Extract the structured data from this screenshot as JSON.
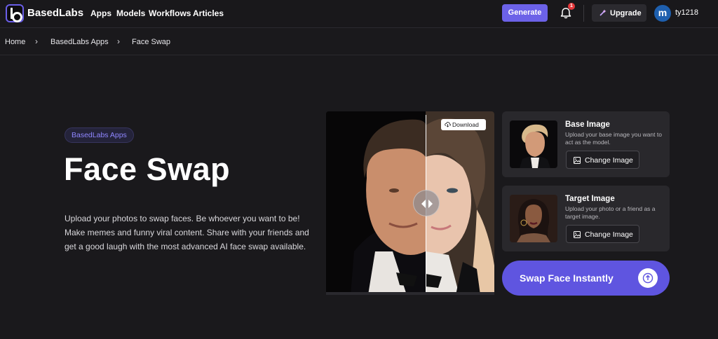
{
  "nav": {
    "brand": "BasedLabs",
    "links": [
      "Apps",
      "Models",
      "Workflows",
      "Articles"
    ],
    "generate_label": "Generate",
    "notification_count": "1",
    "upgrade_label": "Upgrade",
    "avatar_initial": "m",
    "username": "ty1218",
    "accent_color": "#6c62e8"
  },
  "breadcrumb": [
    "Home",
    "BasedLabs Apps",
    "Face Swap"
  ],
  "hero": {
    "pill": "BasedLabs Apps",
    "title": "Face Swap",
    "description": "Upload your photos to swap faces. Be whoever you want to be! Make memes and funny viral content. Share with your friends and get a good laugh with the most advanced AI face swap available."
  },
  "preview": {
    "download_label": "Download"
  },
  "base_card": {
    "title": "Base Image",
    "subtitle": "Upload your base image you want to act as the model.",
    "button_label": "Change Image"
  },
  "target_card": {
    "title": "Target Image",
    "subtitle": "Upload your photo or a friend as a target image.",
    "button_label": "Change Image"
  },
  "swap_button_label": "Swap Face Instantly"
}
